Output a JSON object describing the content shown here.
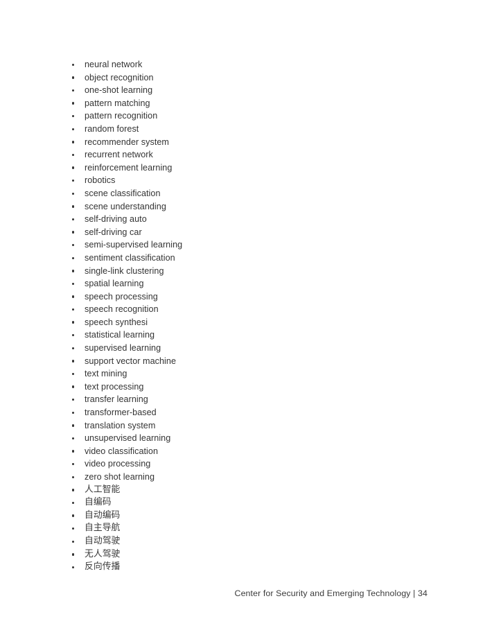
{
  "page": {
    "background_color": "#ffffff",
    "text_color": "#333333"
  },
  "list": {
    "bullet_glyph": "•",
    "items": [
      {
        "label": "neural network",
        "script": "latin"
      },
      {
        "label": "object recognition",
        "script": "latin"
      },
      {
        "label": "one-shot learning",
        "script": "latin"
      },
      {
        "label": "pattern matching",
        "script": "latin"
      },
      {
        "label": "pattern recognition",
        "script": "latin"
      },
      {
        "label": "random forest",
        "script": "latin"
      },
      {
        "label": "recommender system",
        "script": "latin"
      },
      {
        "label": "recurrent network",
        "script": "latin"
      },
      {
        "label": "reinforcement learning",
        "script": "latin"
      },
      {
        "label": "robotics",
        "script": "latin"
      },
      {
        "label": "scene classification",
        "script": "latin"
      },
      {
        "label": "scene understanding",
        "script": "latin"
      },
      {
        "label": "self-driving auto",
        "script": "latin"
      },
      {
        "label": "self-driving car",
        "script": "latin"
      },
      {
        "label": "semi-supervised learning",
        "script": "latin"
      },
      {
        "label": "sentiment classification",
        "script": "latin"
      },
      {
        "label": "single-link clustering",
        "script": "latin"
      },
      {
        "label": "spatial learning",
        "script": "latin"
      },
      {
        "label": "speech processing",
        "script": "latin"
      },
      {
        "label": "speech recognition",
        "script": "latin"
      },
      {
        "label": "speech synthesi",
        "script": "latin"
      },
      {
        "label": "statistical learning",
        "script": "latin"
      },
      {
        "label": "supervised learning",
        "script": "latin"
      },
      {
        "label": "support vector machine",
        "script": "latin"
      },
      {
        "label": "text mining",
        "script": "latin"
      },
      {
        "label": "text processing",
        "script": "latin"
      },
      {
        "label": "transfer learning",
        "script": "latin"
      },
      {
        "label": "transformer-based",
        "script": "latin"
      },
      {
        "label": "translation system",
        "script": "latin"
      },
      {
        "label": "unsupervised learning",
        "script": "latin"
      },
      {
        "label": "video classification",
        "script": "latin"
      },
      {
        "label": "video processing",
        "script": "latin"
      },
      {
        "label": "zero shot learning",
        "script": "latin"
      },
      {
        "label": "人工智能",
        "script": "cjk"
      },
      {
        "label": "自编码",
        "script": "cjk"
      },
      {
        "label": "自动编码",
        "script": "cjk"
      },
      {
        "label": "自主导航",
        "script": "cjk"
      },
      {
        "label": "自动驾驶",
        "script": "cjk"
      },
      {
        "label": "无人驾驶",
        "script": "cjk"
      },
      {
        "label": "反向传播",
        "script": "cjk"
      }
    ]
  },
  "footer": {
    "text": "Center for Security and Emerging Technology | 34",
    "organization": "Center for Security and Emerging Technology",
    "separator": "|",
    "page_number": "34"
  }
}
